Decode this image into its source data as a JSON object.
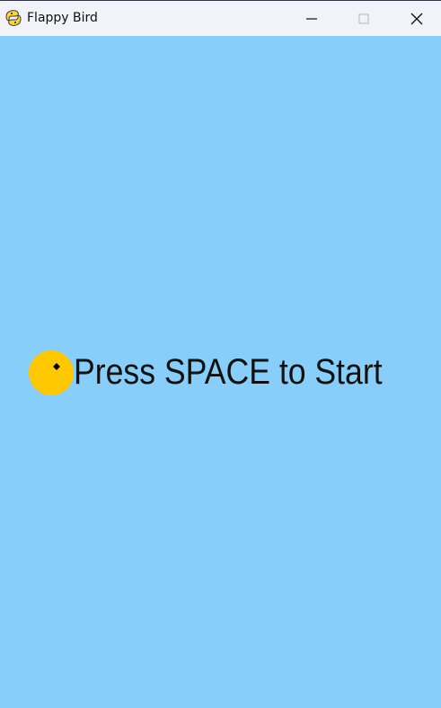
{
  "window": {
    "title": "Flappy Bird",
    "app_icon": "python-snake-icon",
    "controls": {
      "minimize_icon": "minimize-icon",
      "maximize_icon": "maximize-icon",
      "close_icon": "close-icon"
    }
  },
  "game": {
    "state": "start-screen",
    "message": "Press SPACE to Start",
    "bird": {
      "name": "bird",
      "eye": "bird-eye-icon"
    }
  },
  "colors": {
    "sky": "#87CEFA",
    "bird": "#FFC800",
    "text": "#111111",
    "titlebar": "#F1F3F9"
  }
}
